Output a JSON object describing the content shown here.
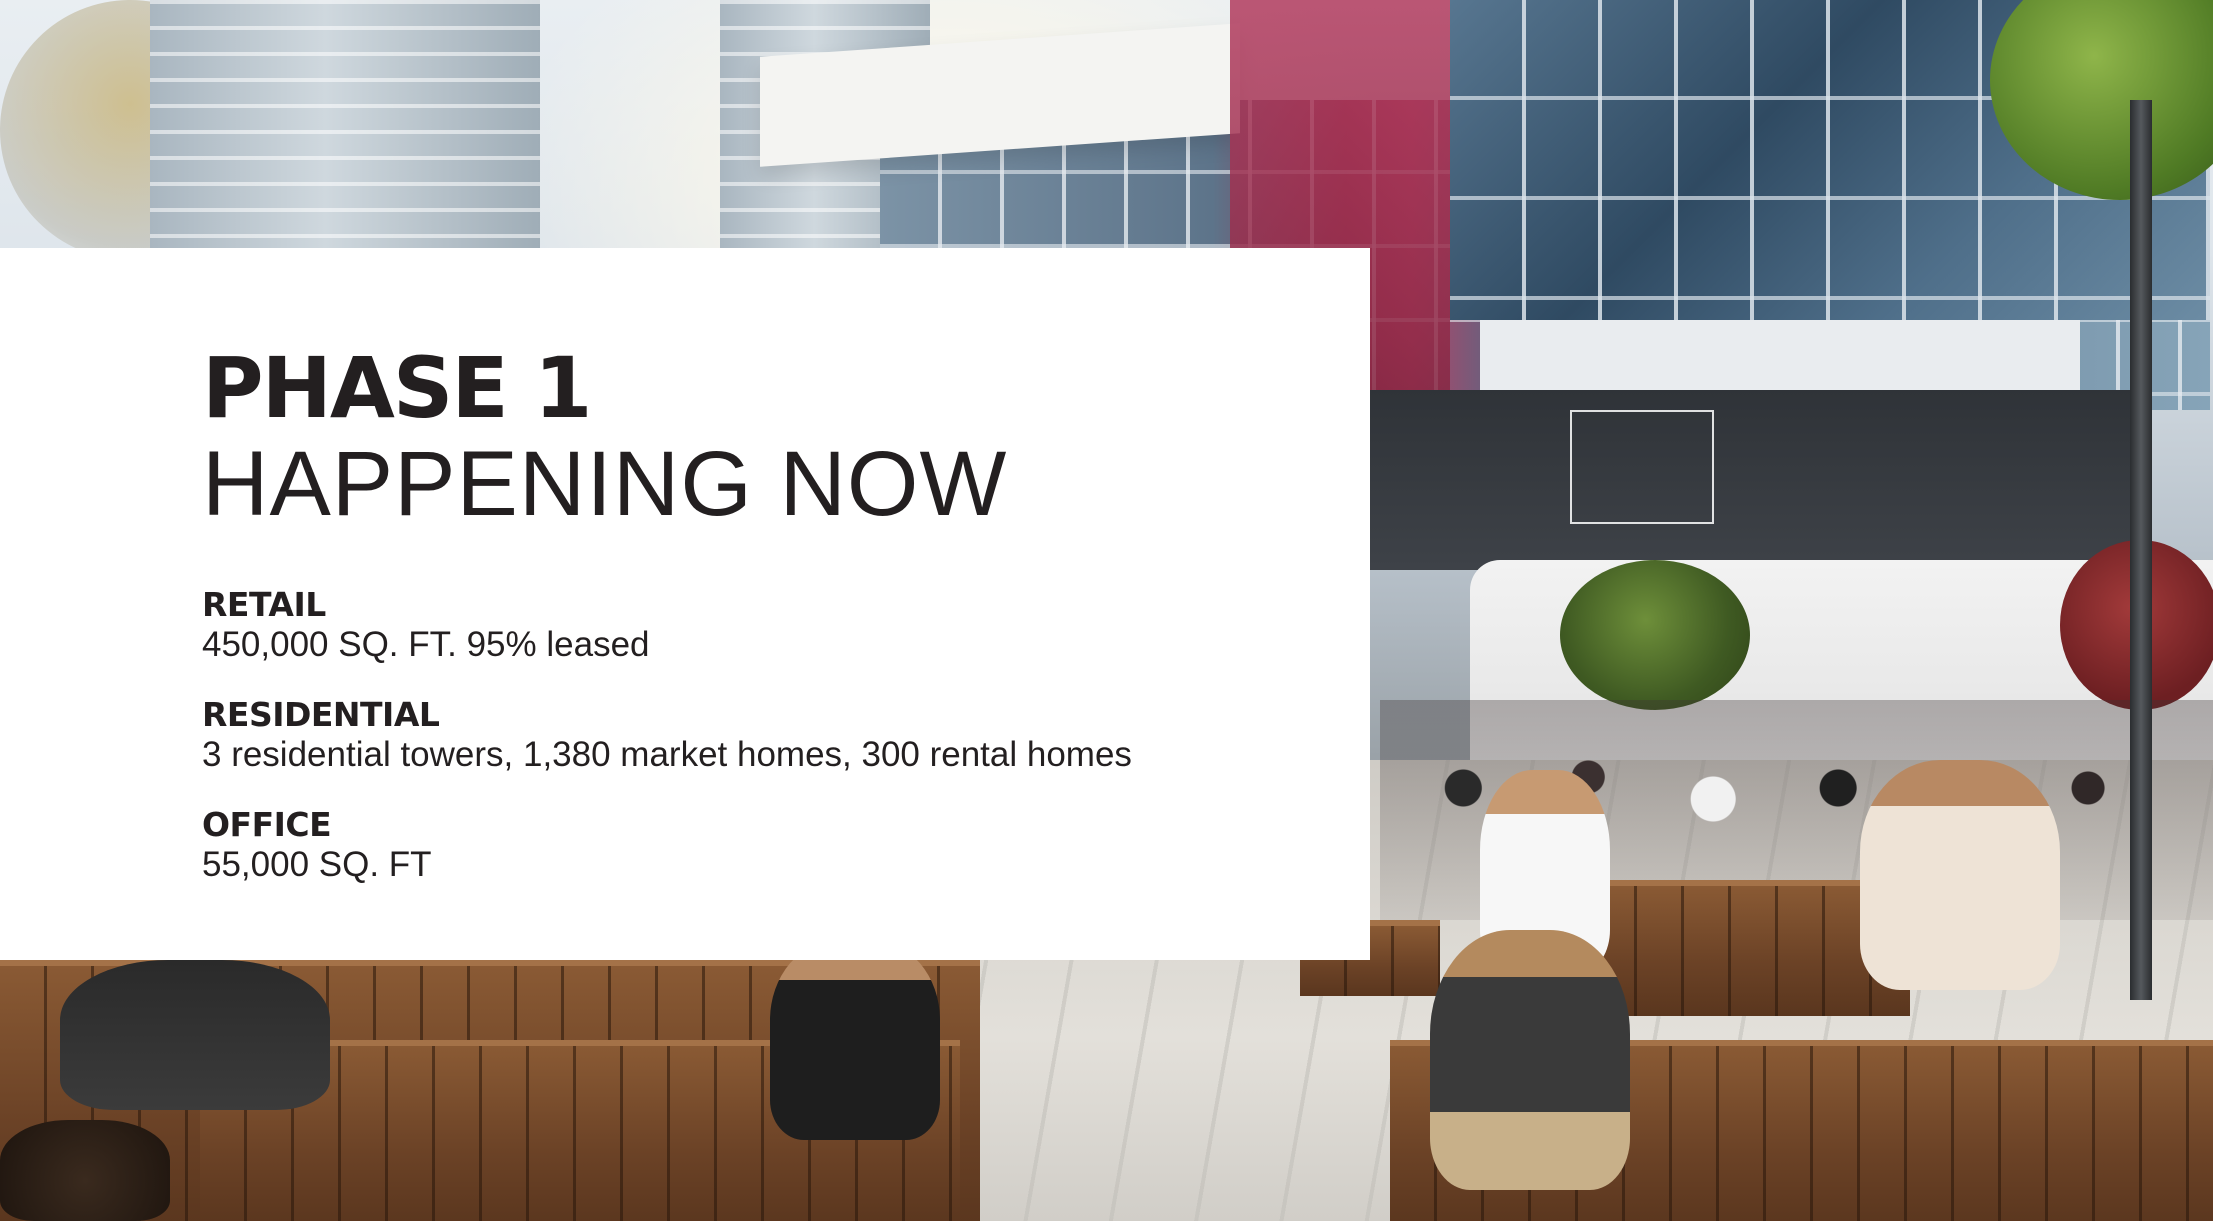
{
  "panel": {
    "title": "PHASE 1",
    "subtitle": "HAPPENING NOW",
    "facts": [
      {
        "label": "RETAIL",
        "value": "450,000 SQ. FT. 95% leased"
      },
      {
        "label": "RESIDENTIAL",
        "value": "3 residential towers, 1,380 market homes, 300 rental homes"
      },
      {
        "label": "OFFICE",
        "value": "55,000 SQ. FT"
      }
    ]
  },
  "colors": {
    "text": "#231f20",
    "panel_background": "#ffffff"
  }
}
